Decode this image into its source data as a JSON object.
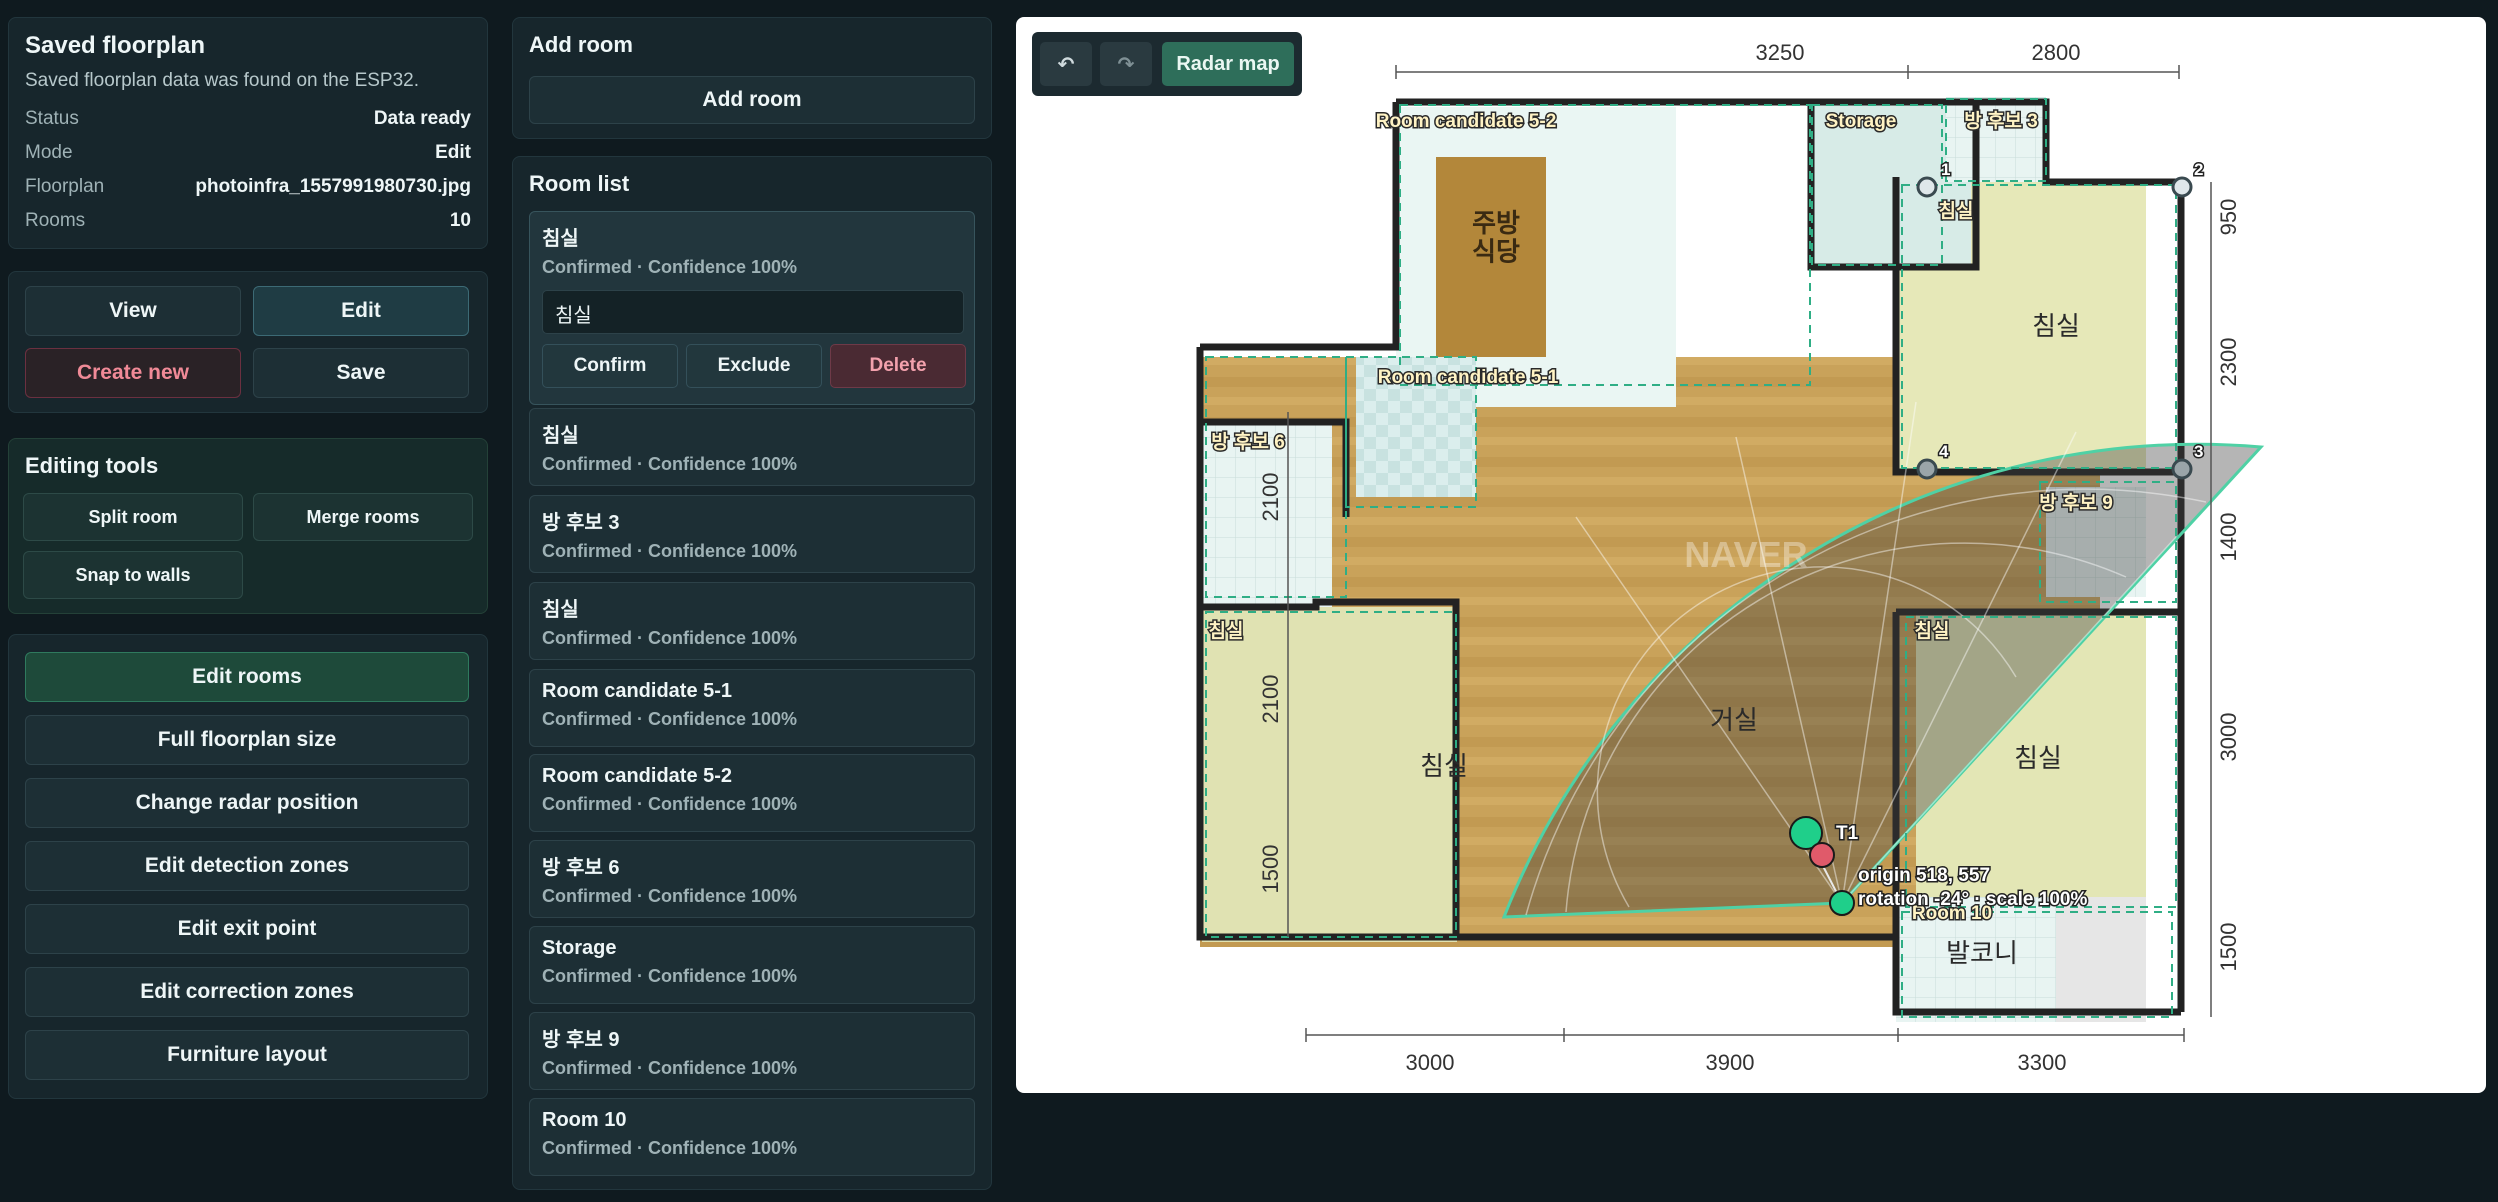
{
  "saved": {
    "title": "Saved floorplan",
    "description": "Saved floorplan data was found on the ESP32.",
    "rows": [
      {
        "k": "Status",
        "v": "Data ready"
      },
      {
        "k": "Mode",
        "v": "Edit"
      },
      {
        "k": "Floorplan",
        "v": "photoinfra_1557991980730.jpg"
      },
      {
        "k": "Rooms",
        "v": "10"
      }
    ]
  },
  "actions": {
    "view": "View",
    "edit": "Edit",
    "create_new": "Create new",
    "save": "Save"
  },
  "tools": {
    "title": "Editing tools",
    "split": "Split room",
    "merge": "Merge rooms",
    "snap": "Snap to walls"
  },
  "modes": [
    "Edit rooms",
    "Full floorplan size",
    "Change radar position",
    "Edit detection zones",
    "Edit exit point",
    "Edit correction zones",
    "Furniture layout"
  ],
  "add_room": {
    "title": "Add room",
    "button": "Add room"
  },
  "room_list": {
    "title": "Room list",
    "selected_input_value": "침실",
    "confirm": "Confirm",
    "exclude": "Exclude",
    "delete": "Delete",
    "rooms": [
      {
        "name": "침실",
        "meta": "Confirmed · Confidence 100%"
      },
      {
        "name": "침실",
        "meta": "Confirmed · Confidence 100%"
      },
      {
        "name": "방 후보 3",
        "meta": "Confirmed · Confidence 100%"
      },
      {
        "name": "침실",
        "meta": "Confirmed · Confidence 100%"
      },
      {
        "name": "Room candidate 5-1",
        "meta": "Confirmed · Confidence 100%"
      },
      {
        "name": "Room candidate 5-2",
        "meta": "Confirmed · Confidence 100%"
      },
      {
        "name": "방 후보 6",
        "meta": "Confirmed · Confidence 100%"
      },
      {
        "name": "Storage",
        "meta": "Confirmed · Confidence 100%"
      },
      {
        "name": "방 후보 9",
        "meta": "Confirmed · Confidence 100%"
      },
      {
        "name": "Room 10",
        "meta": "Confirmed · Confidence 100%"
      }
    ]
  },
  "map": {
    "toolbar": {
      "undo_icon": "undo-icon",
      "redo_icon": "redo-icon",
      "radar_map": "Radar map"
    },
    "dims_top": [
      "3250",
      "2800"
    ],
    "dims_bottom": [
      "3000",
      "3900",
      "3300"
    ],
    "dims_left": [
      "2100",
      "2100",
      "1500"
    ],
    "dims_right": [
      "950",
      "2300",
      "1400",
      "3000",
      "1500"
    ],
    "room_labels": {
      "kitchen": "주방\n식당",
      "living": "거실",
      "bed_top_right": "침실",
      "bed_left": "침실",
      "bed_right": "침실",
      "balcony": "발코니"
    },
    "overlay_labels": {
      "rc52": "Room candidate 5-2",
      "storage": "Storage",
      "r3": "방 후보 3",
      "bed_tag_tr": "침실",
      "rc51": "Room candidate 5-1",
      "r6": "방 후보 6",
      "r9": "방 후보 9",
      "bed_tag_l": "침실",
      "bed_tag_r": "침실",
      "r10": "Room 10"
    },
    "vertex_labels": [
      "1",
      "2",
      "3",
      "4"
    ],
    "target": "T1",
    "origin_text": "origin 518, 557",
    "rotation_text": "rotation -24° · scale 100%",
    "watermark": "NAVER"
  },
  "colors": {
    "accent": "#2e6e5a",
    "zone": "#4fd1a5",
    "target": "#1fcf8a",
    "radar_origin": "#e05a6a"
  }
}
